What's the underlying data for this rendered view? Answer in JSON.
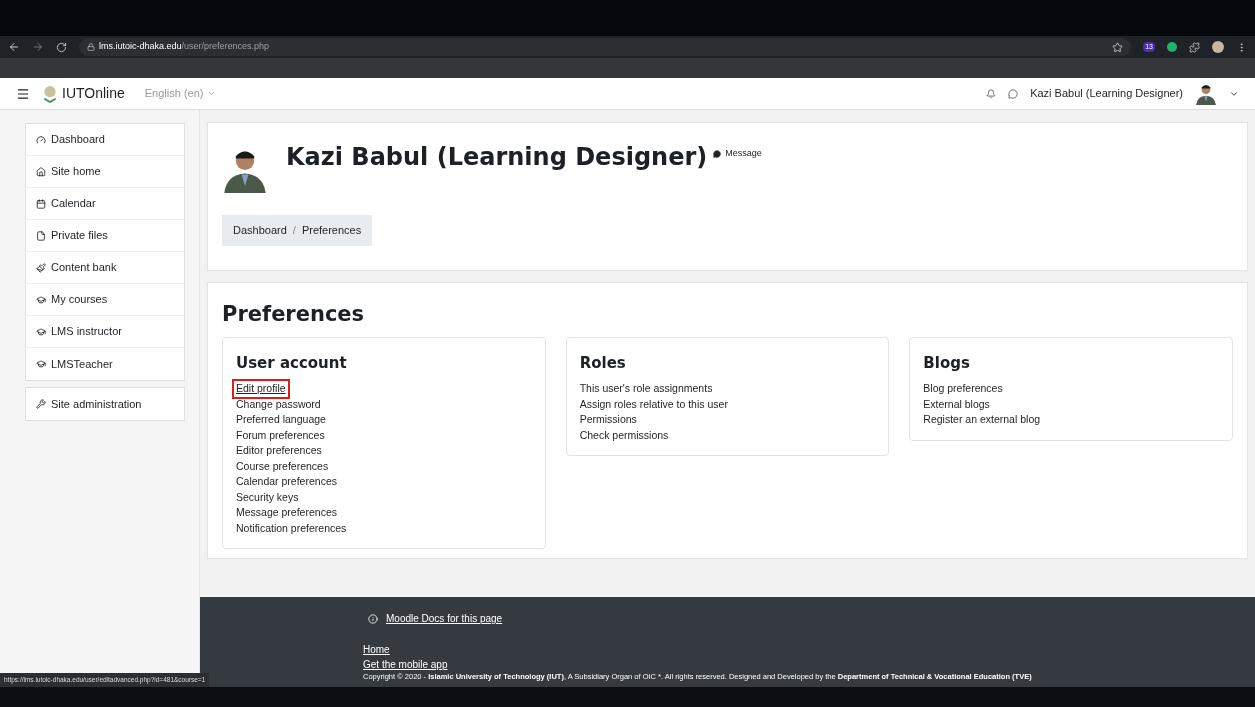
{
  "browser": {
    "url_host": "lms.iutoic-dhaka.edu",
    "url_path": "/user/preferences.php",
    "extension_badge": "13"
  },
  "navbar": {
    "site_name": "IUTOnline",
    "language": "English (en)",
    "user_name": "Kazi Babul (Learning Designer)"
  },
  "sidebar": {
    "groups": [
      [
        {
          "label": "Dashboard"
        },
        {
          "label": "Site home"
        },
        {
          "label": "Calendar"
        },
        {
          "label": "Private files"
        },
        {
          "label": "Content bank"
        },
        {
          "label": "My courses"
        },
        {
          "label": "LMS instructor"
        },
        {
          "label": "LMSTeacher"
        }
      ],
      [
        {
          "label": "Site administration"
        }
      ]
    ]
  },
  "header": {
    "name": "Kazi Babul (Learning Designer)",
    "message_link": "Message",
    "breadcrumb": [
      "Dashboard",
      "Preferences"
    ],
    "breadcrumb_separator": "/"
  },
  "page_title": "Preferences",
  "sections": [
    {
      "title": "User account",
      "links": [
        {
          "label": "Edit profile",
          "highlighted": true
        },
        {
          "label": "Change password",
          "highlighted": false
        },
        {
          "label": "Preferred language",
          "highlighted": false
        },
        {
          "label": "Forum preferences",
          "highlighted": false
        },
        {
          "label": "Editor preferences",
          "highlighted": false
        },
        {
          "label": "Course preferences",
          "highlighted": false
        },
        {
          "label": "Calendar preferences",
          "highlighted": false
        },
        {
          "label": "Security keys",
          "highlighted": false
        },
        {
          "label": "Message preferences",
          "highlighted": false
        },
        {
          "label": "Notification preferences",
          "highlighted": false
        }
      ]
    },
    {
      "title": "Roles",
      "links": [
        {
          "label": "This user's role assignments",
          "highlighted": false
        },
        {
          "label": "Assign roles relative to this user",
          "highlighted": false
        },
        {
          "label": "Permissions",
          "highlighted": false
        },
        {
          "label": "Check permissions",
          "highlighted": false
        }
      ]
    },
    {
      "title": "Blogs",
      "links": [
        {
          "label": "Blog preferences",
          "highlighted": false
        },
        {
          "label": "External blogs",
          "highlighted": false
        },
        {
          "label": "Register an external blog",
          "highlighted": false
        }
      ]
    }
  ],
  "footer": {
    "docs_link": "Moodle Docs for this page",
    "links": [
      "Home",
      "Get the mobile app"
    ],
    "copyright": "Copyright © 2020 - **Islamic University of Technology (IUT)**, A Subsidiary Organ of OIC *. All rights reserved. Designed and Developed by the **Department of Technical & Vocational Education (TVE)**"
  },
  "status_url": "https://lms.iutoic-dhaka.edu/user/editadvanced.php?id=481&course=1"
}
